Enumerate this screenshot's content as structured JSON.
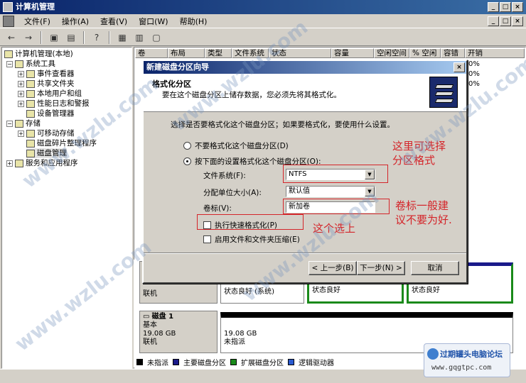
{
  "window": {
    "title": "计算机管理",
    "menu": [
      "文件(F)",
      "操作(A)",
      "查看(V)",
      "窗口(W)",
      "帮助(H)"
    ]
  },
  "tree": {
    "root": "计算机管理(本地)",
    "items": [
      {
        "label": "系统工具",
        "level": 1
      },
      {
        "label": "事件查看器",
        "level": 2
      },
      {
        "label": "共享文件夹",
        "level": 2
      },
      {
        "label": "本地用户和组",
        "level": 2
      },
      {
        "label": "性能日志和警报",
        "level": 2
      },
      {
        "label": "设备管理器",
        "level": 2
      },
      {
        "label": "存储",
        "level": 1
      },
      {
        "label": "可移动存储",
        "level": 2
      },
      {
        "label": "磁盘碎片整理程序",
        "level": 2
      },
      {
        "label": "磁盘管理",
        "level": 2
      },
      {
        "label": "服务和应用程序",
        "level": 1
      }
    ]
  },
  "list": {
    "columns": [
      "卷",
      "布局",
      "类型",
      "文件系统",
      "状态",
      "容量",
      "空闲空间",
      "% 空闲",
      "容错",
      "开销"
    ],
    "pct_values": [
      "0%",
      "0%",
      "0%"
    ]
  },
  "disks": {
    "disk0": {
      "lines": [
        "基",
        "5",
        "联机"
      ],
      "vol1_status": "状态良好 (系统)",
      "vol2_status": "状态良好",
      "vol3_status": "状态良好"
    },
    "disk1": {
      "name": "磁盘 1",
      "type": "基本",
      "size": "19.08 GB",
      "status": "联机",
      "vol_size": "19.08 GB",
      "vol_status": "未指派"
    }
  },
  "legend": [
    "未指派",
    "主要磁盘分区",
    "扩展磁盘分区",
    "逻辑驱动器"
  ],
  "colors": {
    "unallocated": "#000000",
    "primary": "#1a1a8a",
    "extended": "#1a8a1a",
    "logical": "#2a5ad0",
    "annotation": "#d4252a"
  },
  "dialog": {
    "title": "新建磁盘分区向导",
    "heading": "格式化分区",
    "subheading": "要在这个磁盘分区上储存数据，您必须先将其格式化。",
    "prompt": "选择是否要格式化这个磁盘分区；如果要格式化，要使用什么设置。",
    "option_no_format": "不要格式化这个磁盘分区(D)",
    "option_format": "按下面的设置格式化这个磁盘分区(O):",
    "fs_label": "文件系统(F):",
    "fs_value": "NTFS",
    "alloc_label": "分配单位大小(A):",
    "alloc_value": "默认值",
    "volume_label": "卷标(V):",
    "volume_value": "新加卷",
    "quick_format": "执行快速格式化(P)",
    "compress": "启用文件和文件夹压缩(E)",
    "back": "< 上一步(B)",
    "next": "下一步(N) >",
    "cancel": "取消"
  },
  "annotations": {
    "fs_note": "这里可选择分区格式",
    "label_note": "卷标一般建议不要为好.",
    "quick_note": "这个选上"
  },
  "watermarks": [
    "www.wzlu.com",
    "www.wzlu.com",
    "www.wzlu.com",
    "www.wzlu.com",
    "www.wzlu.com"
  ],
  "forum": {
    "name": "过期罐头电脑论坛",
    "url": "www.gqgtpc.com"
  }
}
